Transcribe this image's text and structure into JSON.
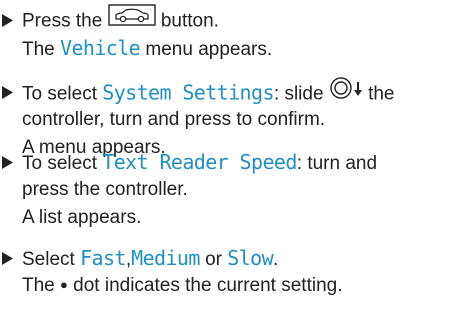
{
  "steps": [
    {
      "lines": [
        {
          "pre": "Press the ",
          "icon": "car-button-icon",
          "post": " button."
        },
        {
          "pre": "The ",
          "hl": "Vehicle",
          "post": " menu appears."
        }
      ]
    },
    {
      "lines": [
        {
          "pre": "To select ",
          "hl": "System Settings",
          "mid": ": slide ",
          "icon": "controller-slide-down-icon",
          "post": " the"
        },
        {
          "text": "controller, turn and press to confirm."
        },
        {
          "text": "A menu appears."
        }
      ]
    },
    {
      "lines": [
        {
          "pre": "To select ",
          "hl": "Text Reader Speed",
          "post": ": turn and"
        },
        {
          "text": "press the controller."
        },
        {
          "text": "A list appears."
        }
      ]
    },
    {
      "lines": [
        {
          "pre": "Select ",
          "hl1": "Fast",
          "sep1": ",",
          "hl2": "Medium",
          "sep2": " or ",
          "hl3": "Slow",
          "post": "."
        },
        {
          "pre": "The ",
          "dot": "●",
          "post": " dot indicates the current setting."
        }
      ]
    }
  ],
  "colors": {
    "highlight": "#1f8fc4",
    "text": "#222222"
  }
}
